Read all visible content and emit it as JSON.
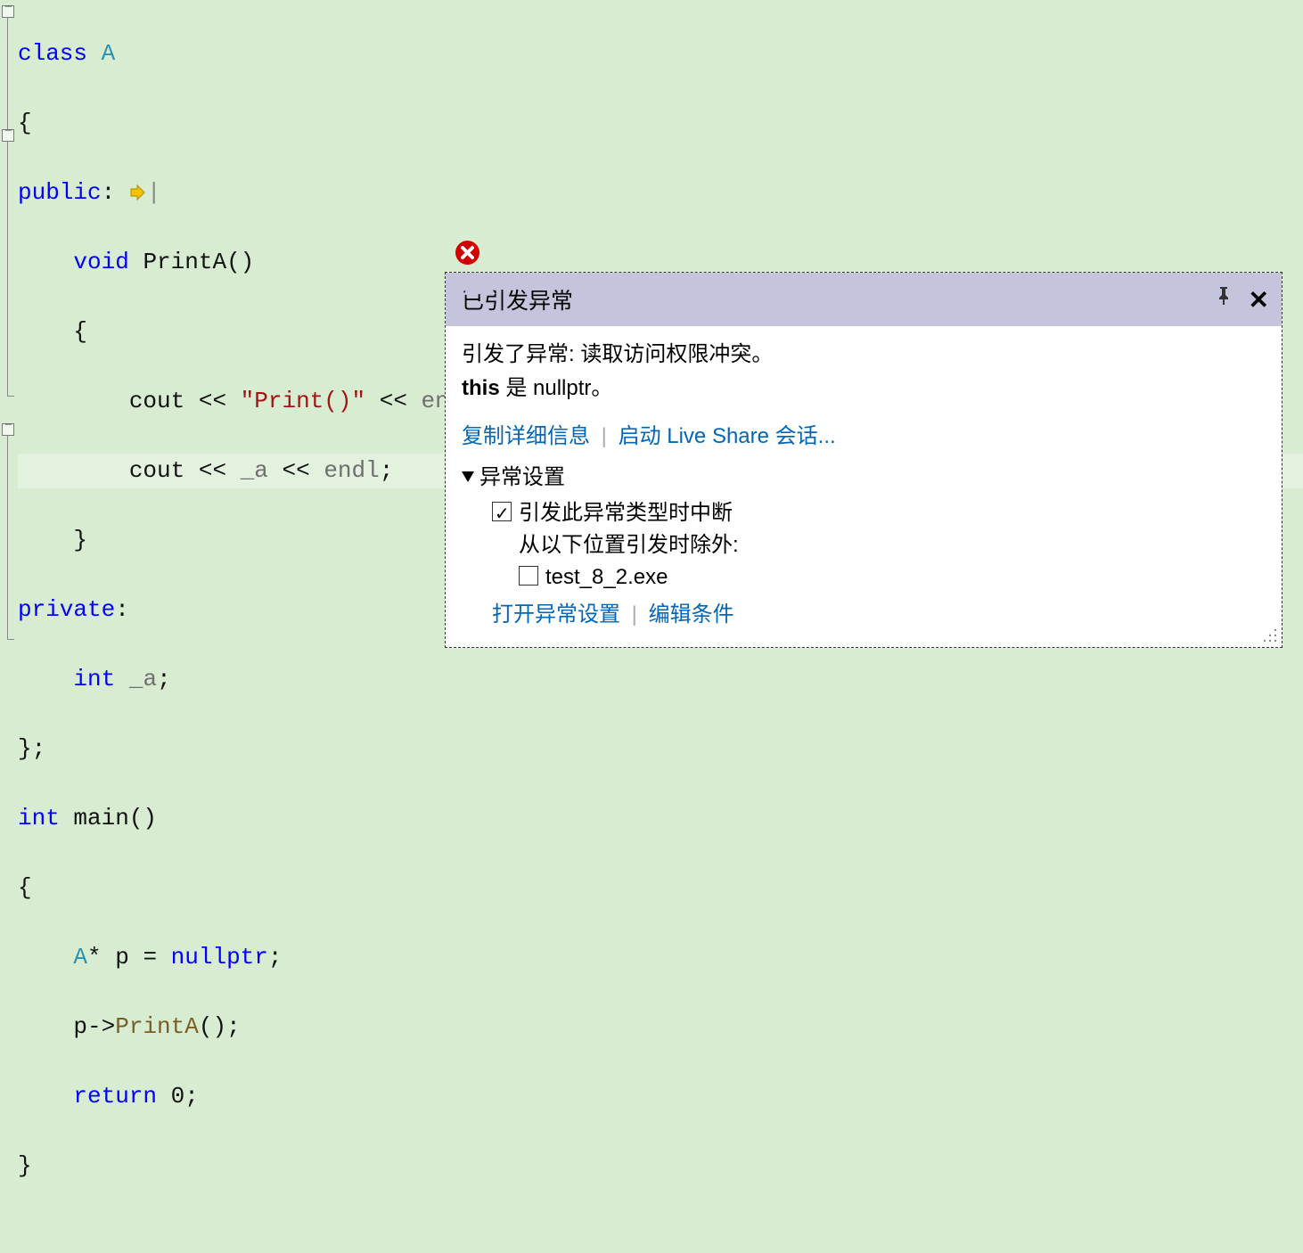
{
  "code": {
    "l1_class": "class",
    "l1_name": "A",
    "l2": "{",
    "l3_public": "public",
    "l3_colon": ":",
    "l4_void": "void",
    "l4_fn": "PrintA()",
    "l5": "{",
    "l6_cout": "cout",
    "l6_op1": " << ",
    "l6_str": "\"Print()\"",
    "l6_op2": " << ",
    "l6_endl": "endl",
    "l6_semi": ";",
    "l7_cout": "cout",
    "l7_op1": " << ",
    "l7_a": "_a",
    "l7_op2": " << ",
    "l7_endl": "endl",
    "l7_semi": ";",
    "l8": "}",
    "l9_private": "private",
    "l9_colon": ":",
    "l10_int": "int",
    "l10_a": "_a",
    "l10_semi": ";",
    "l11": "};",
    "l12_int": "int",
    "l12_main": "main()",
    "l13": "{",
    "l14_type": "A",
    "l14_rest1": "* p = ",
    "l14_null": "nullptr",
    "l14_semi": ";",
    "l15_p": "p->",
    "l15_call": "PrintA",
    "l15_paren": "();",
    "l16_return": "return",
    "l16_zero": " 0;",
    "l17": "}"
  },
  "popup": {
    "title": "已引发异常",
    "msg_line1_prefix": "引发了异常: 读取访问权限冲突。",
    "msg_line2_bold": "this",
    "msg_line2_rest": " 是 nullptr。",
    "copy_details": "复制详细信息",
    "live_share": "启动 Live Share 会话...",
    "settings_title": "异常设置",
    "break_on_type": "引发此异常类型时中断",
    "except_from": "从以下位置引发时除外:",
    "module": "test_8_2.exe",
    "open_settings": "打开异常设置",
    "edit_condition": "编辑条件"
  }
}
